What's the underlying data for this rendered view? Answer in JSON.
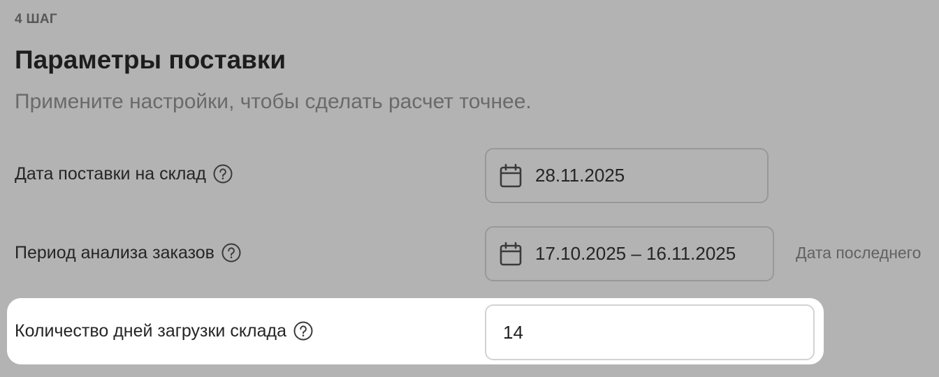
{
  "step_label": "4 ШАГ",
  "title": "Параметры поставки",
  "subtitle": "Примените настройки, чтобы сделать расчет точнее.",
  "rows": {
    "supply_date": {
      "label": "Дата поставки на склад",
      "icon": "help-circle-icon",
      "field_icon": "calendar-icon",
      "value": "28.11.2025"
    },
    "analysis_period": {
      "label": "Период анализа заказов",
      "icon": "help-circle-icon",
      "field_icon": "calendar-icon",
      "value": "17.10.2025 – 16.11.2025",
      "note": "Дата последнего"
    },
    "warehouse_days": {
      "label": "Количество дней загрузки склада",
      "icon": "help-circle-icon",
      "value": "14"
    }
  },
  "colors": {
    "overlay": "#b3b3b3",
    "highlight": "#ffffff",
    "text": "#252525",
    "muted": "#6a6a6a"
  }
}
